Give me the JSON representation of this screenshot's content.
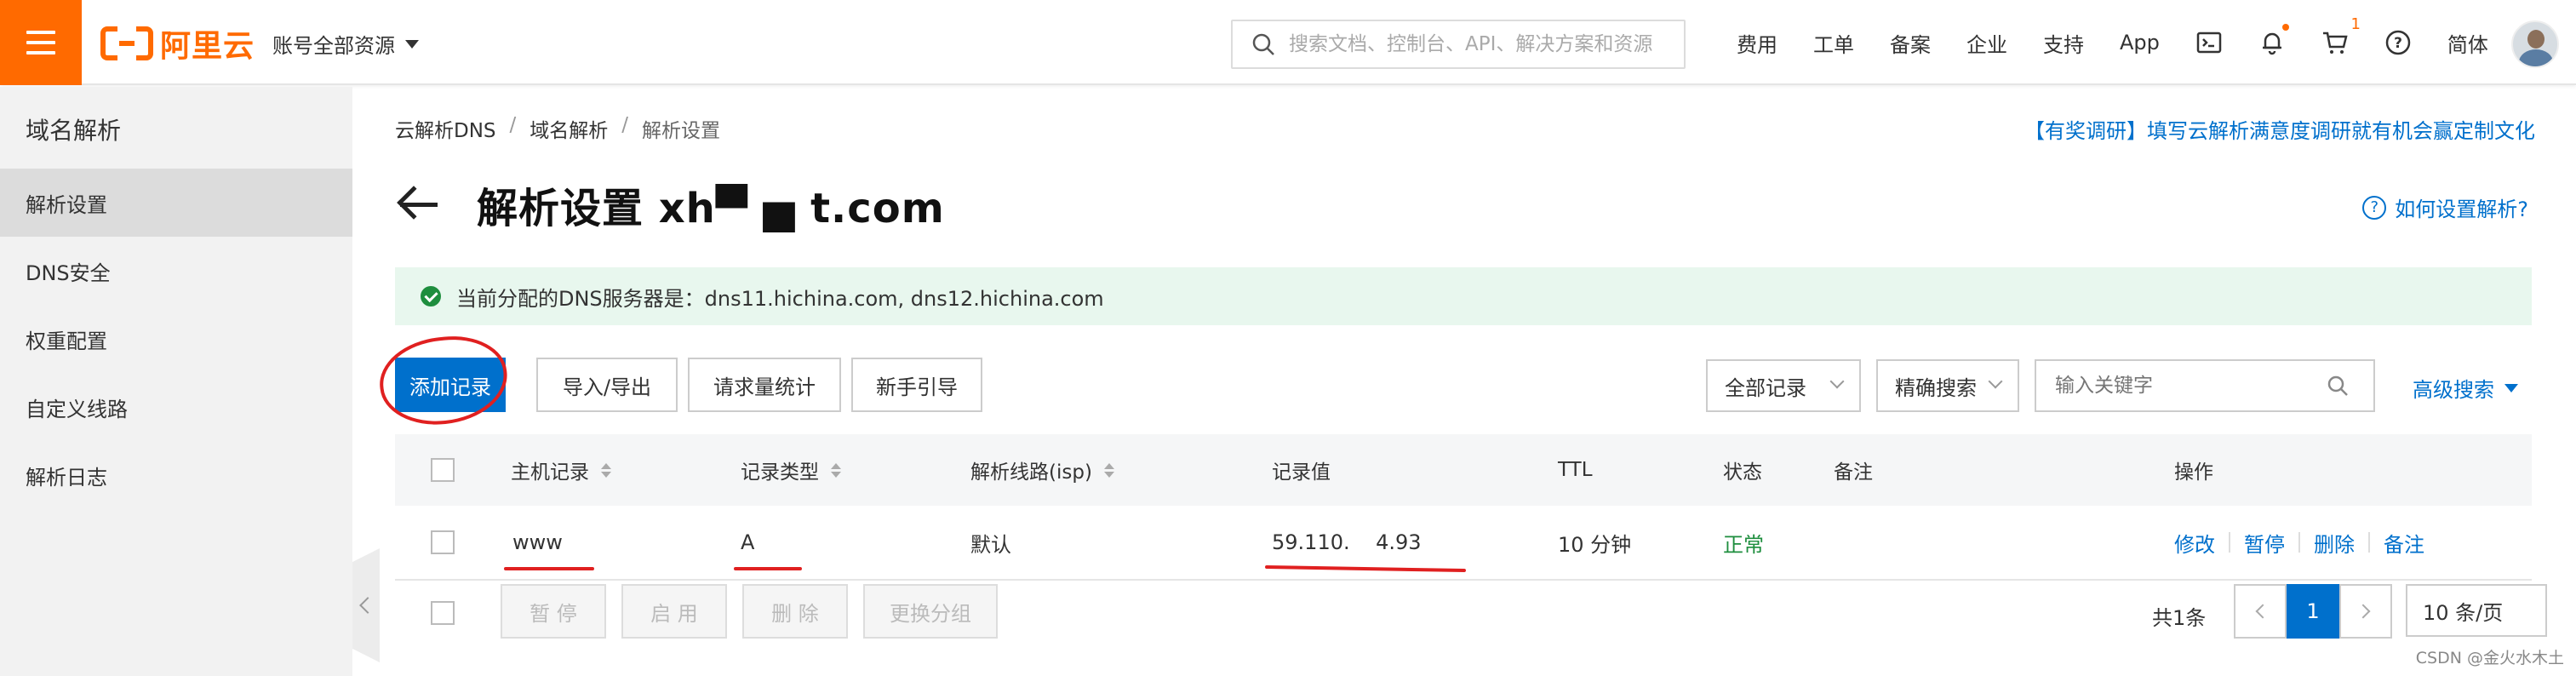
{
  "header": {
    "logo_text": "阿里云",
    "account_label": "账号全部资源",
    "search_placeholder": "搜索文档、控制台、API、解决方案和资源",
    "nav": [
      "费用",
      "工单",
      "备案",
      "企业",
      "支持",
      "App"
    ],
    "cart_badge": "1",
    "lang": "简体",
    "icons": [
      "terminal-icon",
      "bell-icon",
      "cart-icon",
      "help-icon"
    ]
  },
  "sidebar": {
    "title": "域名解析",
    "items": [
      {
        "label": "解析设置",
        "active": true
      },
      {
        "label": "DNS安全"
      },
      {
        "label": "权重配置"
      },
      {
        "label": "自定义线路"
      },
      {
        "label": "解析日志"
      }
    ]
  },
  "breadcrumb": [
    "云解析DNS",
    "/",
    "域名解析",
    "/",
    "解析设置"
  ],
  "promo": "【有奖调研】填写云解析满意度调研就有机会赢定制文化",
  "page": {
    "title": "解析设置 xh▀   ▅ t.com",
    "help": "如何设置解析?"
  },
  "notice": "当前分配的DNS服务器是：dns11.hichina.com, dns12.hichina.com",
  "toolbar": {
    "add": "添加记录",
    "import_export": "导入/导出",
    "stats": "请求量统计",
    "guide": "新手引导",
    "filter_select": "全部记录",
    "match_select": "精确搜索",
    "keyword_placeholder": "输入关键字",
    "advanced": "高级搜索"
  },
  "table": {
    "columns": [
      "主机记录",
      "记录类型",
      "解析线路(isp)",
      "记录值",
      "TTL",
      "状态",
      "备注",
      "操作"
    ],
    "rows": [
      {
        "host": "www",
        "type": "A",
        "line": "默认",
        "value": "59.110.    4.93",
        "ttl": "10 分钟",
        "status": "正常",
        "remark": "",
        "actions": [
          "修改",
          "暂停",
          "删除",
          "备注"
        ]
      }
    ]
  },
  "bulk": {
    "pause": "暂 停",
    "enable": "启 用",
    "delete": "删 除",
    "change_group": "更换分组"
  },
  "pagination": {
    "total": "共1条",
    "current": "1",
    "page_size": "10 条/页"
  },
  "watermark": "CSDN @金火水木土",
  "colors": {
    "brand": "#ff6a00",
    "primary": "#0070cc",
    "success": "#1e8e3e",
    "annotation": "#e02020"
  }
}
